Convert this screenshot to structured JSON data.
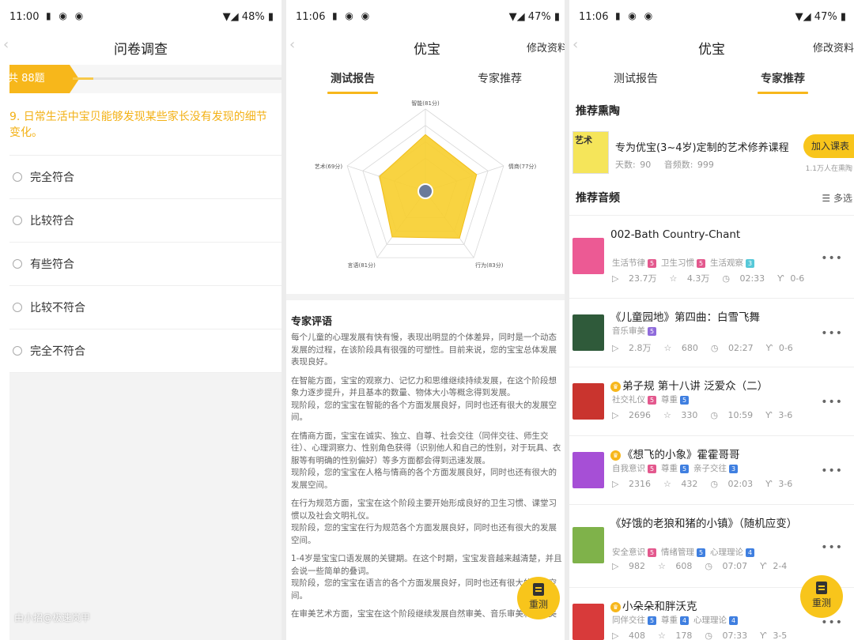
{
  "colors": {
    "accent": "#f7b71b",
    "badge_pink": "#e3588d",
    "badge_purple": "#8f6bdb",
    "badge_blue": "#3f7fe0",
    "badge_teal": "#56c8d8"
  },
  "panel1": {
    "status": {
      "time": "11:00",
      "battery": "48%"
    },
    "title": "问卷调查",
    "question_count": "共 88题",
    "progress": 0.1,
    "question": "9. 日常生活中宝贝能够发现某些家长没有发现的细节变化。",
    "options": [
      "完全符合",
      "比较符合",
      "有些符合",
      "比较不符合",
      "完全不符合"
    ],
    "watermark": "由小招@极速岚甲"
  },
  "panel2": {
    "status": {
      "time": "11:06",
      "battery": "47%"
    },
    "title": "优宝",
    "edit": "修改资料",
    "tabs": [
      "测试报告",
      "专家推荐"
    ],
    "active_tab": 0,
    "review_title": "专家评语",
    "review_paragraphs": [
      "每个儿童的心理发展有快有慢，表现出明显的个体差异，同时是一个动态发展的过程，在该阶段具有很强的可塑性。目前来说，您的宝宝总体发展表现良好。",
      "在智能方面，宝宝的观察力、记忆力和思维继续持续发展，在这个阶段想象力逐步提升，并且基本的数量、物体大小等概念得到发展。\n现阶段，您的宝宝在智能的各个方面发展良好，同时也还有很大的发展空间。",
      "在情商方面，宝宝在诚实、独立、自尊、社会交往（同伴交往、师生交往）、心理洞察力、性别角色获得（识别他人和自己的性别，对于玩具、衣服等有明确的性别偏好）等多方面都会得到迅速发展。\n现阶段，您的宝宝在人格与情商的各个方面发展良好，同时也还有很大的发展空间。",
      "在行为规范方面，宝宝在这个阶段主要开始形成良好的卫生习惯、课堂习惯以及社会文明礼仪。\n现阶段，您的宝宝在行为规范各个方面发展良好，同时也还有很大的发展空间。",
      "1-4岁是宝宝口语发展的关键期。在这个时期，宝宝发音越来越清楚，并且会说一些简单的叠词。\n现阶段，您的宝宝在语言的各个方面发展良好，同时也还有很大的发展空间。",
      "在审美艺术方面，宝宝在这个阶段继续发展自然审美、音乐审美和表现美"
    ],
    "retest": "重测"
  },
  "chart_data": {
    "type": "radar",
    "categories": [
      "智能(81分)",
      "情商(77分)",
      "行为(83分)",
      "言语(81分)",
      "艺术(69分)"
    ],
    "values": [
      81,
      77,
      83,
      81,
      69
    ],
    "ylim": [
      0,
      100
    ]
  },
  "panel3": {
    "status": {
      "time": "11:06",
      "battery": "47%"
    },
    "title": "优宝",
    "edit": "修改资料",
    "tabs": [
      "测试报告",
      "专家推荐"
    ],
    "active_tab": 1,
    "section_course": "推荐熏陶",
    "course": {
      "thumb_text": "艺术",
      "title": "专为优宝(3~4岁)定制的艺术修养课程",
      "days": "天数: 90",
      "episodes": "音频数: 999",
      "join": "加入课表",
      "joined": "1.1万人在熏陶"
    },
    "section_audio": "推荐音频",
    "multi": "多选",
    "tracks": [
      {
        "title": "002-Bath Country-Chant",
        "vip": false,
        "tags": [
          {
            "t": "生活节律",
            "n": "5",
            "c": "pink"
          },
          {
            "t": "卫生习惯",
            "n": "5",
            "c": "pink"
          },
          {
            "t": "生活观察",
            "n": "3",
            "c": "teal"
          }
        ],
        "plays": "23.7万",
        "likes": "4.3万",
        "duration": "02:33",
        "age": "0-6",
        "thumb": "#ec5a94"
      },
      {
        "title": "《儿童园地》第四曲：白雪飞舞",
        "vip": false,
        "tags": [
          {
            "t": "音乐审美",
            "n": "5",
            "c": "purple"
          }
        ],
        "plays": "2.8万",
        "likes": "680",
        "duration": "02:27",
        "age": "0-6",
        "thumb": "#2f5a3a"
      },
      {
        "title": "弟子规 第十八讲 泛爱众（二）",
        "vip": true,
        "tags": [
          {
            "t": "社交礼仪",
            "n": "5",
            "c": "pink"
          },
          {
            "t": "尊重",
            "n": "5",
            "c": "blue"
          }
        ],
        "plays": "2696",
        "likes": "330",
        "duration": "10:59",
        "age": "3-6",
        "thumb": "#c9342e"
      },
      {
        "title": "《想飞的小象》霍霍哥哥",
        "vip": true,
        "tags": [
          {
            "t": "自我意识",
            "n": "5",
            "c": "pink"
          },
          {
            "t": "尊重",
            "n": "5",
            "c": "blue"
          },
          {
            "t": "亲子交往",
            "n": "3",
            "c": "blue"
          }
        ],
        "plays": "2316",
        "likes": "432",
        "duration": "02:03",
        "age": "3-6",
        "thumb": "#a64fd6"
      },
      {
        "title": "《好饿的老狼和猪的小镇》（随机应变）",
        "vip": false,
        "tags": [
          {
            "t": "安全意识",
            "n": "5",
            "c": "pink"
          },
          {
            "t": "情绪管理",
            "n": "5",
            "c": "blue"
          },
          {
            "t": "心理理论",
            "n": "4",
            "c": "blue"
          }
        ],
        "plays": "982",
        "likes": "608",
        "duration": "07:07",
        "age": "2-4",
        "thumb": "#7fb24a"
      },
      {
        "title": "小朵朵和胖沃克",
        "vip": true,
        "tags": [
          {
            "t": "同伴交往",
            "n": "5",
            "c": "blue"
          },
          {
            "t": "尊重",
            "n": "4",
            "c": "blue"
          },
          {
            "t": "心理理论",
            "n": "4",
            "c": "blue"
          }
        ],
        "plays": "408",
        "likes": "178",
        "duration": "07:33",
        "age": "3-5",
        "thumb": "#d83a3a"
      }
    ],
    "retest": "重测"
  }
}
